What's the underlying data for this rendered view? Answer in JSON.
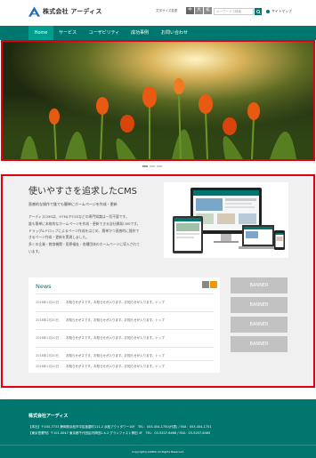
{
  "header": {
    "logo_text": "株式会社 アーディス",
    "font_size_label": "文字サイズ変更",
    "font_sizes": [
      "中",
      "大",
      "拡"
    ],
    "search_placeholder": "キーワードで検索",
    "sitemap_label": "サイトマップ"
  },
  "nav": {
    "items": [
      "Home",
      "サービス",
      "ユーザビリティ",
      "成功事例",
      "お問い合わせ"
    ]
  },
  "main": {
    "title": "使いやすさを追求したCMS",
    "subtitle": "直感的な操作で誰でも簡単にホームページを作成・更新",
    "desc_lines": [
      "アーディスCMSは、HTMLやCSSなどの専門知識は一切不要です。",
      "誰も簡単に本格的なホームページを作成・更新できる自社開発CMSです。",
      "ドラッグ&ドロップによるページ作成をはじめ、簡単かつ直感的に操作で",
      "きるページ作成・更新を実現しました。",
      "多くの企業・教育機関・医療福祉・各種団体のホームページに導入されて",
      "います。"
    ]
  },
  "news": {
    "title": "News",
    "items": [
      {
        "date": "2016年2月20日",
        "text": "お知らせがスです。お知らせが入ります。お知らせが入ります。トップ"
      },
      {
        "date": "2016年2月20日",
        "text": "お知らせがスです。お知らせが入ります。お知らせが入ります。トップ"
      },
      {
        "date": "2016年2月20日",
        "text": "お知らせがスです。お知らせが入ります。お知らせが入ります。トップ"
      },
      {
        "date": "2016年2月20日",
        "text": "お知らせがスです。お知らせが入ります。お知らせが入ります。トップ"
      },
      {
        "date": "2016年2月20日",
        "text": "お知らせがスです。お知らせが入ります。お知らせが入ります。トップ"
      }
    ]
  },
  "banners": [
    "BANNER",
    "BANNER",
    "BANNER",
    "BANNER"
  ],
  "footer": {
    "company": "株式会社アーディス",
    "line1": "【本社】〒430-7733 静岡県浜松市中区板屋町111-2 浜松アクトタワー10F　TEL：053-454-1750(代表) / FAX：053-454-1751",
    "line2": "【東京営業所】〒101-0047 東京都千代田区内神田2-4-2 グランファスト神田 4F　TEL：03-5207-6466 / FAX：03-5207-6465",
    "copyright": "Copyright(c)ARDIS All Rights Reserved."
  },
  "colors": {
    "brand": "#00776e",
    "highlight_border": "#e2000f",
    "banner": "#c2c2c2"
  }
}
